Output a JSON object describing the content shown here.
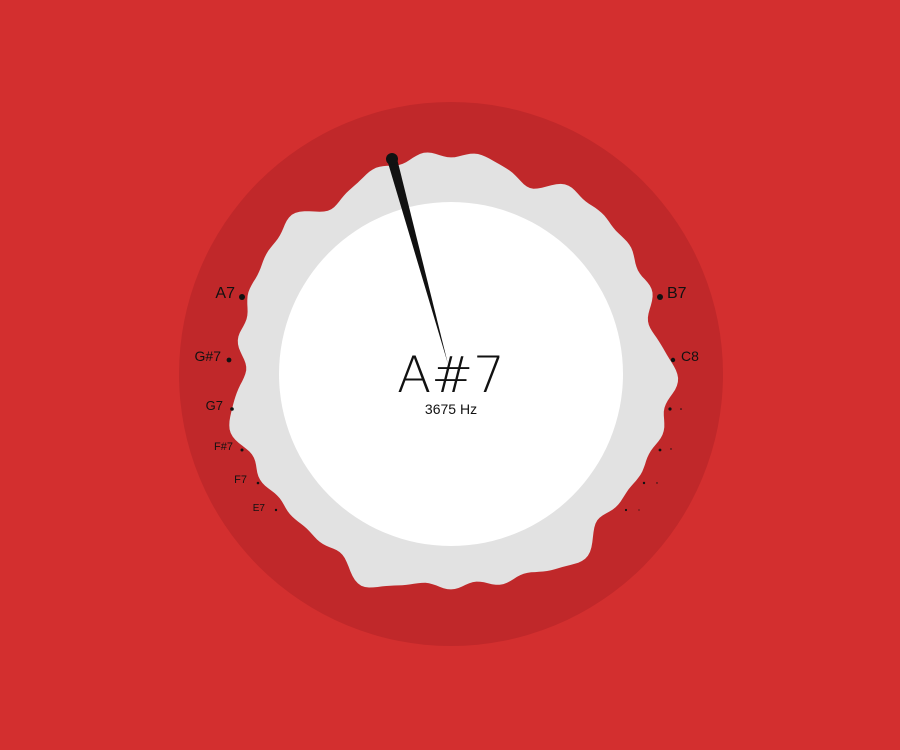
{
  "tuner": {
    "current_note": "A#7",
    "frequency_label": "3675 Hz",
    "needle_note": "A#7"
  },
  "scale": {
    "left": [
      "A7",
      "G#7",
      "G7",
      "F#7",
      "F7",
      "E7"
    ],
    "right": [
      "B7",
      "C8",
      "",
      "",
      "",
      ""
    ]
  },
  "colors": {
    "background": "#d32f2f",
    "outer_ring": "#c0282a",
    "waveform": "#e2e2e2",
    "dial_center": "#ffffff",
    "needle": "#111111",
    "text": "#111111"
  }
}
